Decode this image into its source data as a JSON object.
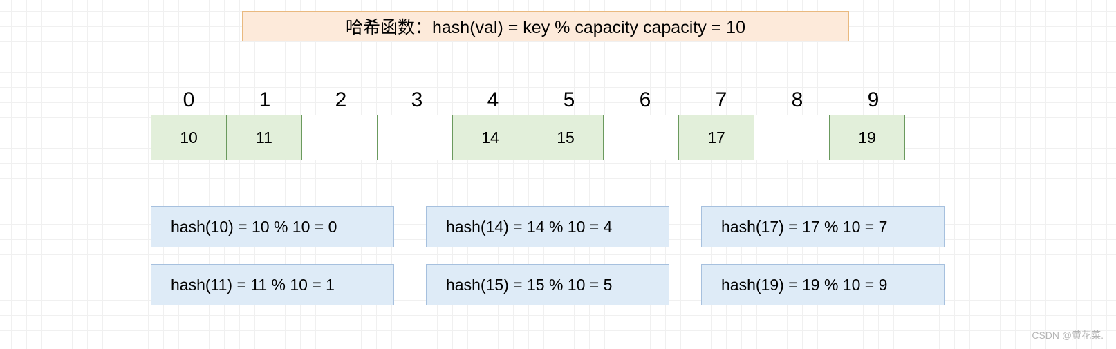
{
  "header": {
    "text": "哈希函数：hash(val) = key % capacity  capacity = 10"
  },
  "array": {
    "indices": [
      "0",
      "1",
      "2",
      "3",
      "4",
      "5",
      "6",
      "7",
      "8",
      "9"
    ],
    "cells": [
      {
        "value": "10",
        "filled": true
      },
      {
        "value": "11",
        "filled": true
      },
      {
        "value": "",
        "filled": false
      },
      {
        "value": "",
        "filled": false
      },
      {
        "value": "14",
        "filled": true
      },
      {
        "value": "15",
        "filled": true
      },
      {
        "value": "",
        "filled": false
      },
      {
        "value": "17",
        "filled": true
      },
      {
        "value": "",
        "filled": false
      },
      {
        "value": "19",
        "filled": true
      }
    ]
  },
  "calculations": {
    "row1": [
      {
        "text": "hash(10) = 10 % 10 = 0"
      },
      {
        "text": "hash(14) = 14 % 10 = 4"
      },
      {
        "text": "hash(17) = 17 % 10 = 7"
      }
    ],
    "row2": [
      {
        "text": "hash(11) = 11 % 10 = 1"
      },
      {
        "text": "hash(15) = 15 % 10 = 5"
      },
      {
        "text": "hash(19) = 19 % 10 = 9"
      }
    ]
  },
  "watermark": "CSDN @黄花菜."
}
